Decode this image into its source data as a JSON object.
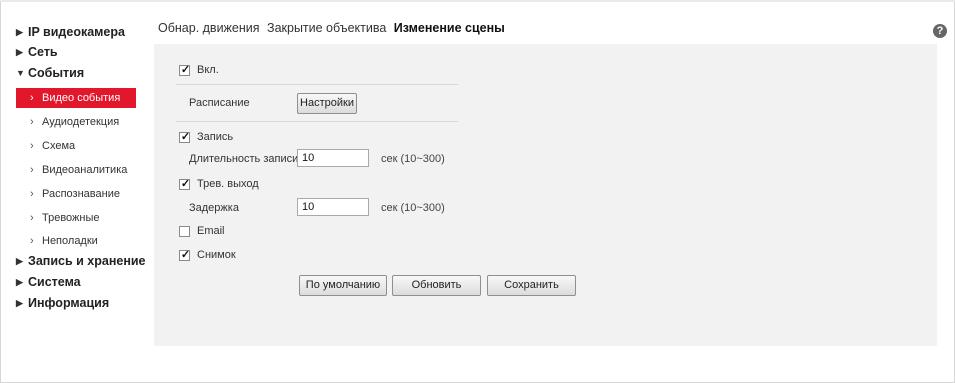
{
  "sidebar": {
    "items": [
      {
        "label": "IP видеокамера",
        "expanded": false
      },
      {
        "label": "Сеть",
        "expanded": false
      },
      {
        "label": "События",
        "expanded": true
      },
      {
        "label": "Запись и хранение",
        "expanded": false
      },
      {
        "label": "Система",
        "expanded": false
      },
      {
        "label": "Информация",
        "expanded": false
      }
    ],
    "sub_items": [
      {
        "label": "Видео события",
        "active": true
      },
      {
        "label": "Аудиодетекция"
      },
      {
        "label": "Схема"
      },
      {
        "label": "Видеоаналитика"
      },
      {
        "label": "Распознавание"
      },
      {
        "label": "Тревожные"
      },
      {
        "label": "Неполадки"
      }
    ]
  },
  "tabs": [
    {
      "label": "Обнар. движения",
      "active": false
    },
    {
      "label": "Закрытие объектива",
      "active": false
    },
    {
      "label": "Изменение сцены",
      "active": true
    }
  ],
  "help_icon": "?",
  "form": {
    "enable": {
      "label": "Вкл.",
      "checked": true
    },
    "schedule": {
      "label": "Расписание",
      "button": "Настройки"
    },
    "record": {
      "label": "Запись",
      "checked": true
    },
    "record_duration": {
      "label": "Длительность записи",
      "value": "10",
      "hint": "сек (10~300)"
    },
    "alarm_out": {
      "label": "Трев. выход",
      "checked": true
    },
    "delay": {
      "label": "Задержка",
      "value": "10",
      "hint": "сек (10~300)"
    },
    "email": {
      "label": "Email",
      "checked": false
    },
    "snapshot": {
      "label": "Снимок",
      "checked": true
    }
  },
  "buttons": {
    "default": "По умолчанию",
    "refresh": "Обновить",
    "save": "Сохранить"
  },
  "check_glyph": "✓",
  "colors": {
    "accent": "#e3172b",
    "panel_bg": "#f2f2f2"
  }
}
